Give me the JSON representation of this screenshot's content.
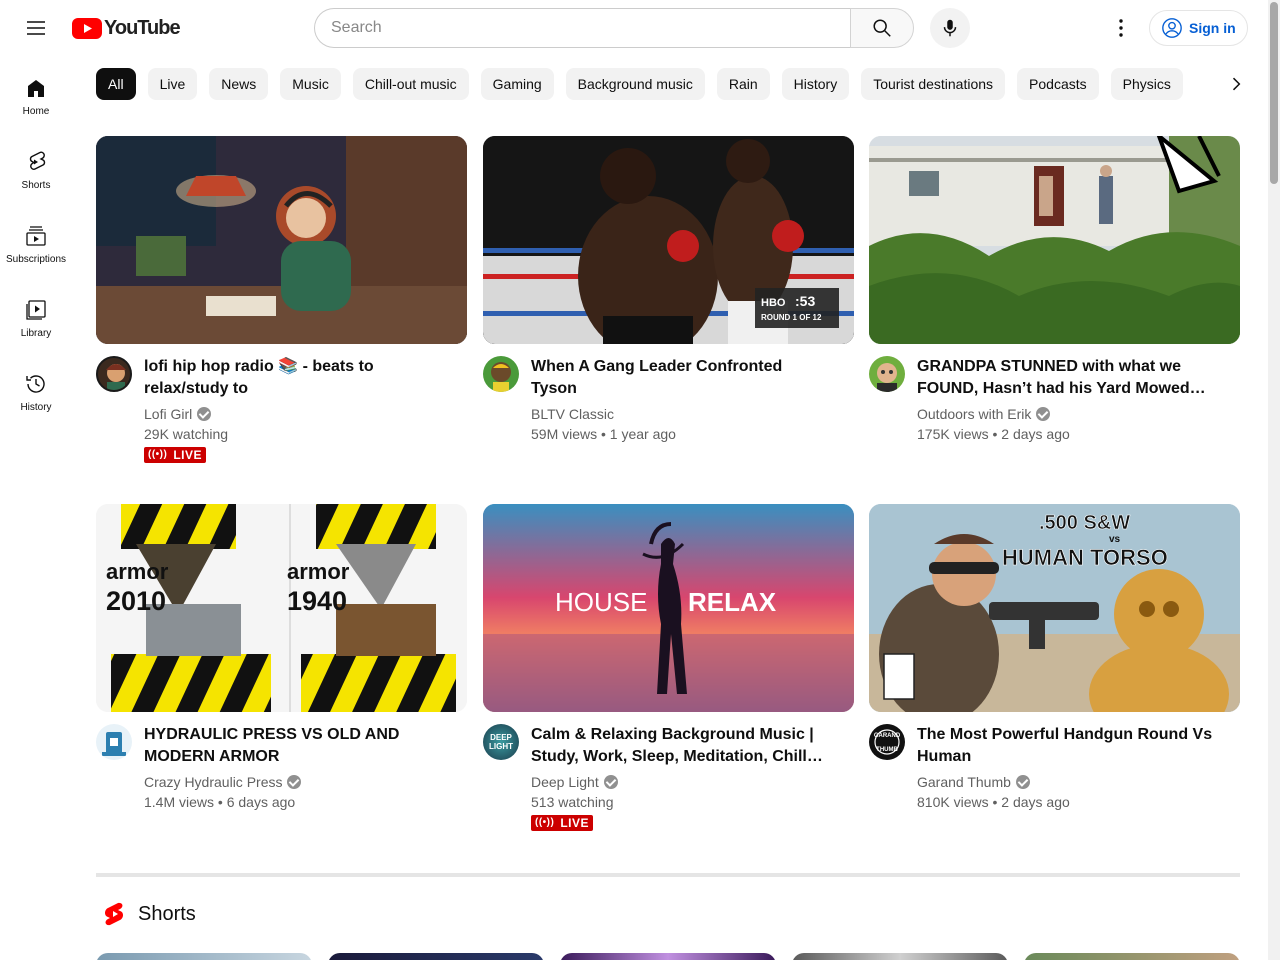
{
  "header": {
    "logo_text": "YouTube",
    "search_placeholder": "Search",
    "sign_in_label": "Sign in",
    "icons": [
      "menu-icon",
      "youtube-logo-icon",
      "search-icon",
      "mic-icon",
      "more-vert-icon",
      "account-icon"
    ]
  },
  "sidebar": {
    "items": [
      {
        "label": "Home",
        "icon": "home-icon"
      },
      {
        "label": "Shorts",
        "icon": "shorts-icon"
      },
      {
        "label": "Subscriptions",
        "icon": "subscriptions-icon"
      },
      {
        "label": "Library",
        "icon": "library-icon"
      },
      {
        "label": "History",
        "icon": "history-icon"
      }
    ]
  },
  "chips": [
    "All",
    "Live",
    "News",
    "Music",
    "Chill-out music",
    "Gaming",
    "Background music",
    "Rain",
    "History",
    "Tourist destinations",
    "Podcasts",
    "Physics"
  ],
  "videos": [
    {
      "title": "lofi hip hop radio 📚 - beats to relax/study to",
      "channel": "Lofi Girl",
      "verified": true,
      "stats": "29K watching",
      "live": true,
      "live_label": "LIVE"
    },
    {
      "title": "When A Gang Leader Confronted Tyson",
      "channel": "BLTV Classic",
      "verified": false,
      "stats": "59M views • 1 year ago",
      "live": false,
      "thumb_text": ":53",
      "thumb_subtext": "ROUND 1 OF 12",
      "thumb_logo": "HBO"
    },
    {
      "title": "GRANDPA STUNNED with what we FOUND, Hasn’t had his Yard Mowed in…",
      "channel": "Outdoors with Erik",
      "verified": true,
      "stats": "175K views • 2 days ago",
      "live": false
    },
    {
      "title": "HYDRAULIC PRESS VS OLD AND MODERN ARMOR",
      "channel": "Crazy Hydraulic Press",
      "verified": true,
      "stats": "1.4M views • 6 days ago",
      "live": false,
      "thumb_left": "armor\n2010",
      "thumb_right": "armor\n1940"
    },
    {
      "title": "Calm & Relaxing Background Music | Study, Work, Sleep, Meditation, Chill -…",
      "channel": "Deep Light",
      "verified": true,
      "stats": "513 watching",
      "live": true,
      "live_label": "LIVE",
      "thumb_left": "HOUSE",
      "thumb_right": "RELAX",
      "avatar_text": "DEEP LIGHT"
    },
    {
      "title": "The Most Powerful Handgun Round Vs Human",
      "channel": "Garand Thumb",
      "verified": true,
      "stats": "810K views • 2 days ago",
      "live": false,
      "thumb_top": ".500 S&W",
      "thumb_mid": "vs",
      "thumb_bottom": "HUMAN TORSO",
      "avatar_text": "GARAND THUMB"
    }
  ],
  "shorts": {
    "heading": "Shorts",
    "icon": "shorts-logo-icon"
  },
  "colors": {
    "brand_red": "#ff0000",
    "link_blue": "#065fd4",
    "live_red": "#cc0000"
  }
}
